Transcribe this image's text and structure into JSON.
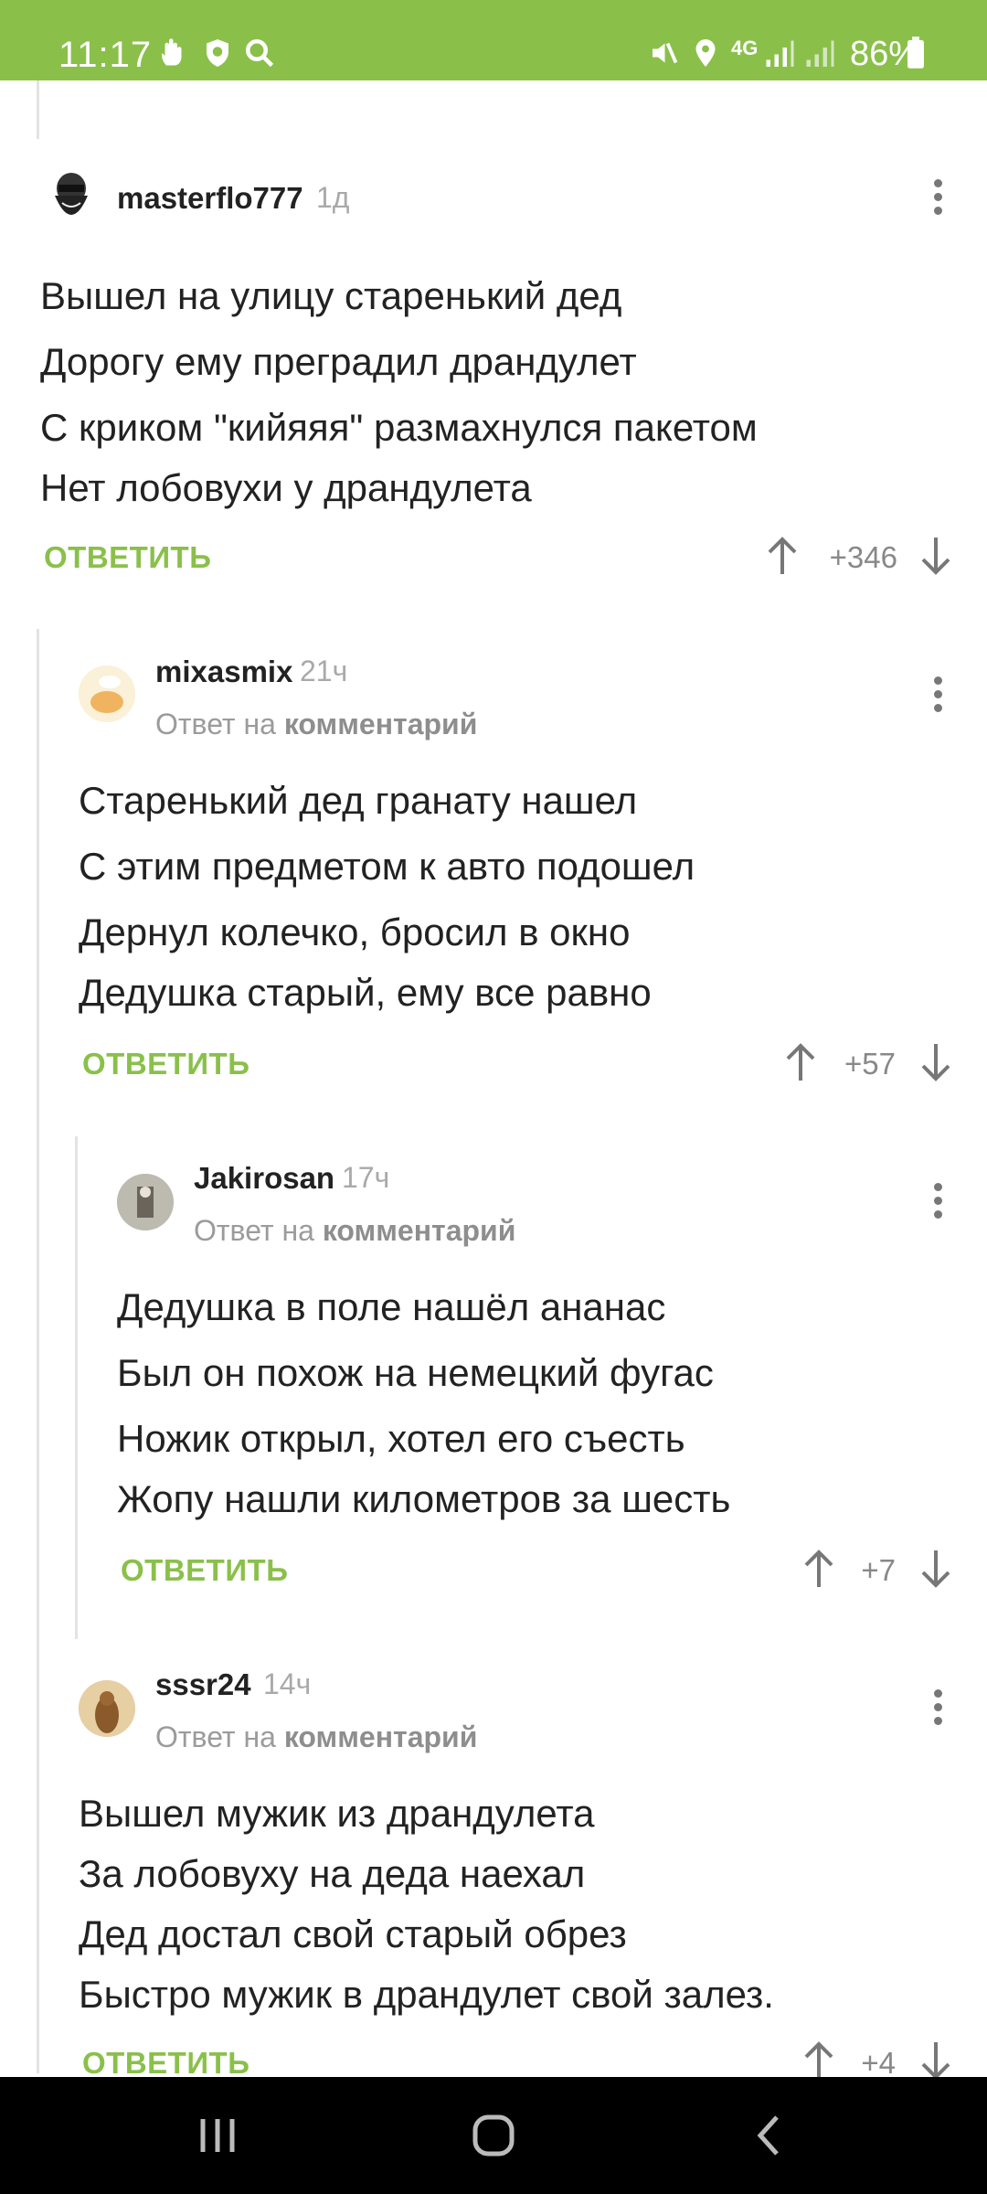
{
  "status_bar": {
    "time": "11:17",
    "battery": "86%",
    "network": "4G",
    "accent_color": "#8ac04a"
  },
  "comments": [
    {
      "user": "masterflo777",
      "age": "1д",
      "reply_prefix": "",
      "reply_link": "",
      "lines": [
        "Вышел на улицу старенький дед",
        "Дорогу ему преградил драндулет",
        "С криком \"кийяяя\" размахнулся пакетом",
        "Нет лобовухи у драндулета"
      ],
      "answer": "ОТВЕТИТЬ",
      "score": "+346"
    },
    {
      "user": "mixasmix",
      "age": "21ч",
      "reply_prefix": "Ответ на",
      "reply_link": "комментарий",
      "lines": [
        "Старенький дед гранату нашел",
        "С этим предметом к авто подошел",
        "Дернул колечко, бросил в окно",
        "Дедушка старый, ему все равно"
      ],
      "answer": "ОТВЕТИТЬ",
      "score": "+57"
    },
    {
      "user": "Jakirosan",
      "age": "17ч",
      "reply_prefix": "Ответ на",
      "reply_link": "комментарий",
      "lines": [
        "Дедушка в поле нашёл ананас",
        "Был он похож на немецкий фугас",
        "Ножик открыл, хотел его съесть",
        "Жопу нашли километров за шесть"
      ],
      "answer": "ОТВЕТИТЬ",
      "score": "+7"
    },
    {
      "user": "sssr24",
      "age": "14ч",
      "reply_prefix": "Ответ на",
      "reply_link": "комментарий",
      "lines": [
        "Вышел мужик из драндулета",
        "За лобовуху на деда наехал",
        "Дед достал свой старый обрез",
        "Быстро мужик в драндулет свой залез."
      ],
      "answer": "ОТВЕТИТЬ",
      "score": "+4"
    }
  ]
}
